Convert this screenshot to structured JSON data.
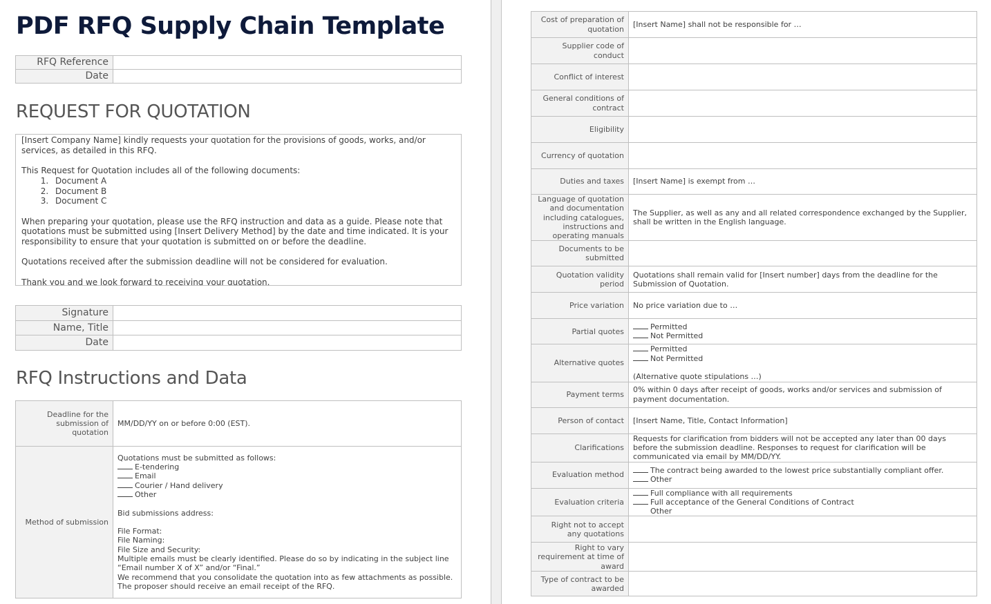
{
  "document": {
    "title": "PDF RFQ Supply Chain Template",
    "header_fields": [
      {
        "label": "RFQ Reference",
        "value": ""
      },
      {
        "label": "Date",
        "value": ""
      }
    ],
    "section_request": {
      "heading": "REQUEST FOR QUOTATION",
      "intro": "[Insert Company Name] kindly requests your quotation for the provisions of goods, works, and/or services, as detailed in this RFQ.",
      "docs_intro": "This Request for Quotation includes all of the following documents:",
      "documents": [
        "Document A",
        "Document B",
        "Document C"
      ],
      "instructions": "When preparing your quotation, please use the RFQ instruction and data as a guide. Please note that quotations must be submitted using [Insert Delivery Method] by the date and time indicated. It is your responsibility to ensure that your quotation is submitted on or before the deadline.",
      "late_notice": "Quotations received after the submission deadline will not be considered for evaluation.",
      "closing": "Thank you and we look forward to receiving your quotation."
    },
    "signature_fields": [
      {
        "label": "Signature",
        "value": ""
      },
      {
        "label": "Name, Title",
        "value": ""
      },
      {
        "label": "Date",
        "value": ""
      }
    ],
    "section_instructions": {
      "heading": "RFQ Instructions and Data",
      "deadline": {
        "label": "Deadline for the submission of quotation",
        "value": "MM/DD/YY on or before 0:00 (EST)."
      },
      "method": {
        "label": "Method of submission",
        "intro": "Quotations must be submitted as follows:",
        "options": [
          "E-tendering",
          "Email",
          "Courier / Hand delivery",
          "Other"
        ],
        "address": "Bid submissions address:",
        "file_format": "File Format:",
        "file_naming": "File Naming:",
        "file_size": "File Size and Security:",
        "multiple_emails": "Multiple emails must be clearly identified. Please do so by indicating in the subject line “Email number X of X” and/or “Final.”",
        "consolidate": "We recommend that you consolidate the quotation into as few attachments as possible.",
        "receipt": "The proposer should receive an email receipt of the RFQ."
      }
    },
    "terms": {
      "cost_prep": {
        "label": "Cost of preparation of quotation",
        "value": "[Insert Name] shall not be responsible for …"
      },
      "supplier_code": {
        "label": "Supplier code of conduct",
        "value": ""
      },
      "conflict": {
        "label": "Conflict of interest",
        "value": ""
      },
      "general_conditions": {
        "label": "General conditions of contract",
        "value": ""
      },
      "eligibility": {
        "label": "Eligibility",
        "value": ""
      },
      "currency": {
        "label": "Currency of quotation",
        "value": ""
      },
      "duties": {
        "label": "Duties and taxes",
        "value": "[Insert Name] is exempt from …"
      },
      "language": {
        "label": "Language of quotation and documentation including catalogues, instructions and operating manuals",
        "value": "The Supplier, as well as any and all related correspondence exchanged by the Supplier, shall be written in the English language."
      },
      "documents": {
        "label": "Documents to be submitted",
        "value": ""
      },
      "validity": {
        "label": "Quotation validity period",
        "value": "Quotations shall remain valid for [Insert number] days from the deadline for the Submission of Quotation."
      },
      "price_variation": {
        "label": "Price variation",
        "value": "No price variation due to …"
      },
      "partial": {
        "label": "Partial quotes",
        "options": [
          "Permitted",
          "Not Permitted"
        ]
      },
      "alternative": {
        "label": "Alternative quotes",
        "options": [
          "Permitted",
          "Not Permitted"
        ],
        "note": "(Alternative quote stipulations …)"
      },
      "payment": {
        "label": "Payment terms",
        "value": "0% within 0 days after receipt of goods, works and/or services and submission of payment documentation."
      },
      "contact": {
        "label": "Person of contact",
        "value": "[Insert Name, Title, Contact Information]"
      },
      "clarifications": {
        "label": "Clarifications",
        "value": "Requests for clarification from bidders will not be accepted any later than 00 days before the submission deadline. Responses to request for clarification will be communicated via email by MM/DD/YY."
      },
      "eval_method": {
        "label": "Evaluation method",
        "options": [
          "The contract being awarded to the lowest price substantially compliant offer.",
          "Other"
        ]
      },
      "eval_criteria": {
        "label": "Evaluation criteria",
        "options": [
          "Full compliance with all requirements",
          "Full acceptance of the General Conditions of Contract"
        ],
        "other": "Other"
      },
      "right_not_accept": {
        "label": "Right not to accept any quotations",
        "value": ""
      },
      "right_vary": {
        "label": "Right to vary requirement at time of award",
        "value": ""
      },
      "contract_type": {
        "label": "Type of contract to be awarded",
        "value": ""
      }
    }
  },
  "colors": {
    "title": "#0e1a3a",
    "label_bg": "#f2f2f2",
    "border": "#bfbfbf",
    "text": "#404040",
    "divider": "#efefef"
  }
}
